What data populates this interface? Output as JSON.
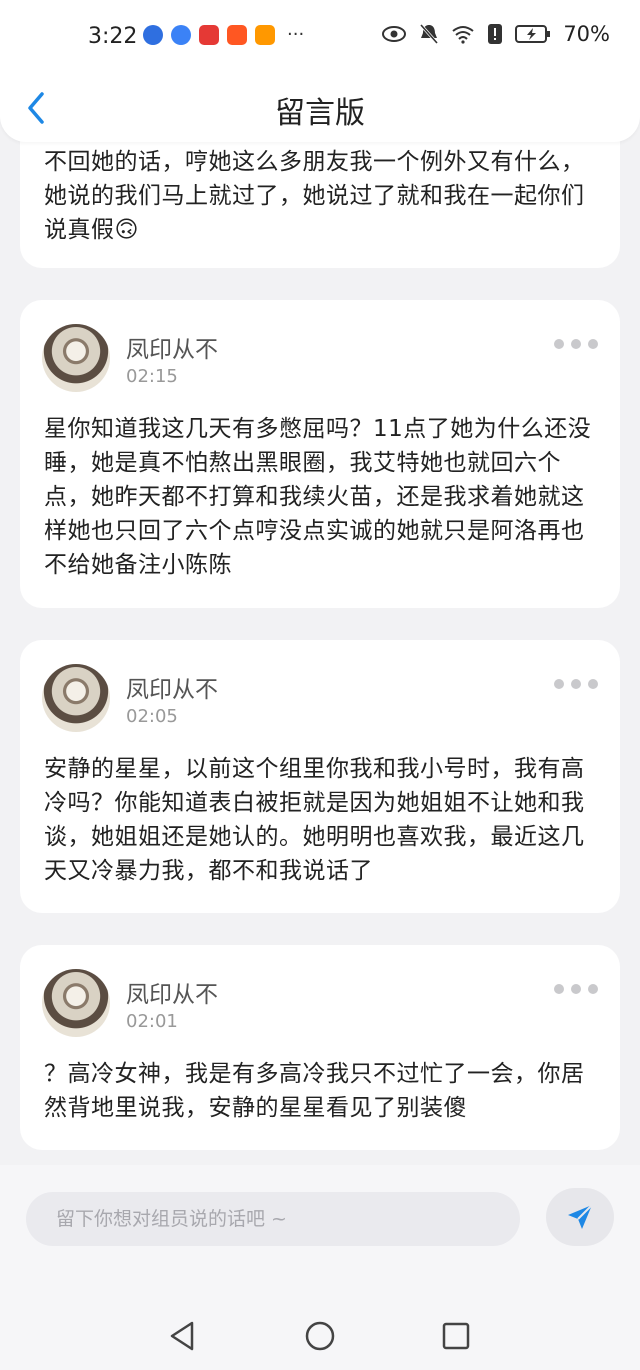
{
  "status_bar": {
    "time": "3:22",
    "more": "···",
    "battery": "70%",
    "app_icons": [
      "baidu-icon",
      "browser-icon",
      "notes-icon",
      "taobao-icon",
      "video-icon"
    ]
  },
  "header": {
    "title": "留言版"
  },
  "posts": [
    {
      "text": "不回她的话，哼她这么多朋友我一个例外又有什么，她说的我们马上就过了，她说过了就和我在一起你们说真假🙃"
    },
    {
      "user": "凤印从不",
      "time": "02:15",
      "text": "星你知道我这几天有多憋屈吗？11点了她为什么还没睡，她是真不怕熬出黑眼圈，我艾特她也就回六个点，她昨天都不打算和我续火苗，还是我求着她就这样她也只回了六个点哼没点实诚的她就只是阿洛再也不给她备注小陈陈"
    },
    {
      "user": "凤印从不",
      "time": "02:05",
      "text": "安静的星星，以前这个组里你我和我小号时，我有高冷吗？你能知道表白被拒就是因为她姐姐不让她和我谈，她姐姐还是她认的。她明明也喜欢我，最近这几天又冷暴力我，都不和我说话了"
    },
    {
      "user": "凤印从不",
      "time": "02:01",
      "text": "？高冷女神，我是有多高冷我只不过忙了一会，你居然背地里说我，安静的星星看见了别装傻"
    }
  ],
  "composer": {
    "placeholder": "留下你想对组员说的话吧 ~",
    "value": ""
  },
  "colors": {
    "accent": "#1e88e5",
    "background": "#f2f2f4",
    "card": "#ffffff"
  }
}
